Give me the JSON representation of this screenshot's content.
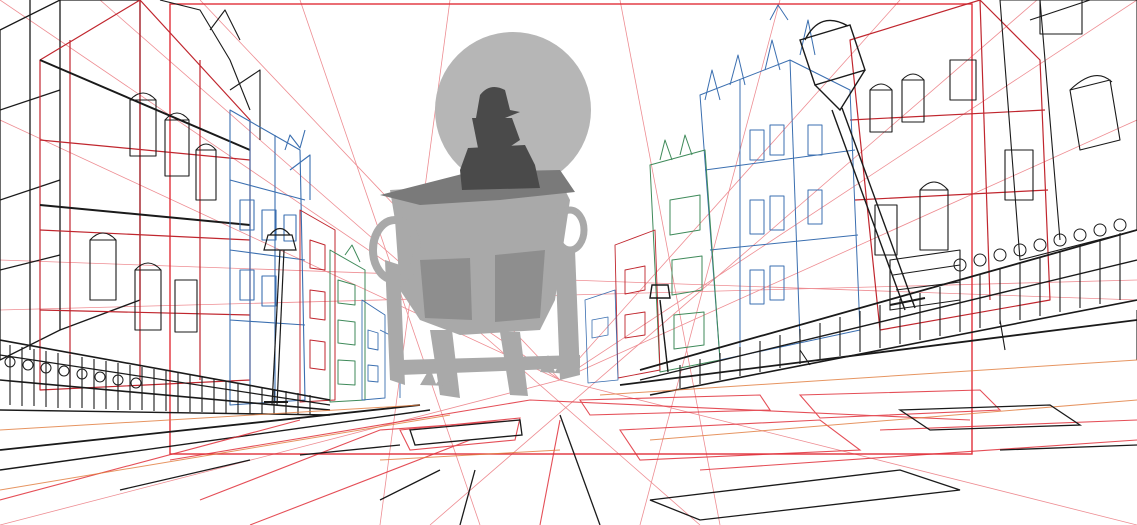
{
  "image": {
    "description_kind": "layout-sketch",
    "palette": {
      "background": "#ffffff",
      "ink": "#1a1a1a",
      "red_construction": "#e0303a",
      "blue_buildings": "#3b6fb0",
      "green_buildings": "#3f8a5a",
      "orange_road": "#e07a3a",
      "silhouette_dark": "#7a7a7a",
      "silhouette_light": "#a9a9a9",
      "moon": "#b6b6b6"
    },
    "elements": [
      "left-building-row",
      "right-building-row",
      "street-lamp-left",
      "street-lamp-right",
      "iron-fence-left",
      "iron-fence-right",
      "cobblestone-road",
      "carriage-silhouette",
      "figure-silhouette",
      "moon-circle",
      "safe-frame-rectangle",
      "perspective-guides"
    ]
  }
}
